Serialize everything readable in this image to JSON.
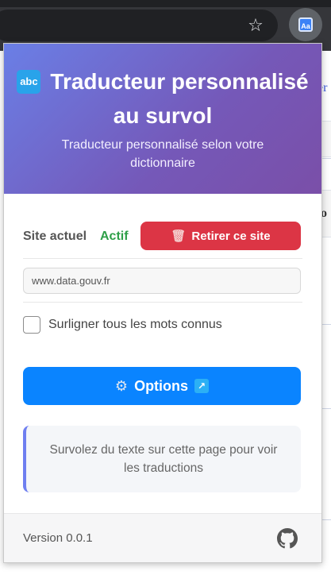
{
  "popup": {
    "logo_text": "abc",
    "title": "Traducteur personnalisé au survol",
    "subtitle": "Traducteur personnalisé selon votre dictionnaire",
    "site_label": "Site actuel",
    "site_status": "Actif",
    "remove_button": "Retirer ce site",
    "current_url": "www.data.gouv.fr",
    "highlight_checkbox_label": "Surligner tous les mots connus",
    "highlight_checked": false,
    "options_button": "Options",
    "info_text": "Survolez du texte sur cette page pour voir les traductions",
    "version": "Version 0.0.1"
  },
  "browser": {
    "extension_icon_label": "Aa"
  },
  "colors": {
    "header_gradient_start": "#6a7fe6",
    "header_gradient_end": "#7a4fa8",
    "status_active": "#2e9f48",
    "remove_button": "#dc3545",
    "options_button": "#0a84ff",
    "info_accent": "#6f7ff0"
  },
  "icons": [
    "star-icon",
    "extension-icon",
    "logo-icon",
    "trash-icon",
    "gear-icon",
    "external-link-icon",
    "github-icon"
  ]
}
